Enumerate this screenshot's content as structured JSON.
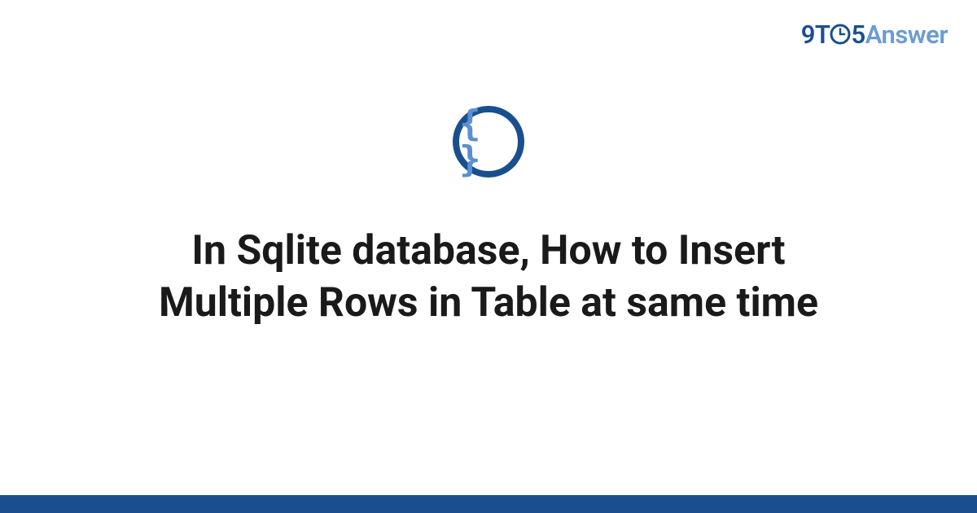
{
  "brand": {
    "part1": "9T",
    "part2": "5",
    "part3": "Answer"
  },
  "badge": {
    "glyph": "{ }"
  },
  "content": {
    "title": "In Sqlite database, How to Insert Multiple Rows in Table at same time"
  },
  "colors": {
    "primary": "#1a4f8f",
    "secondary": "#6b9bd1",
    "accent": "#5b8fcf"
  }
}
